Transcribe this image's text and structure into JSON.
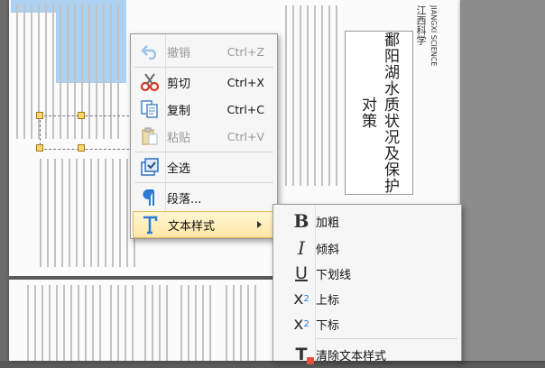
{
  "context_menu": {
    "items": [
      {
        "label": "撤销",
        "shortcut": "Ctrl+Z",
        "icon": "undo-icon",
        "enabled": false
      },
      {
        "label": "剪切",
        "shortcut": "Ctrl+X",
        "icon": "scissors-icon",
        "enabled": true
      },
      {
        "label": "复制",
        "shortcut": "Ctrl+C",
        "icon": "copy-icon",
        "enabled": true
      },
      {
        "label": "粘贴",
        "shortcut": "Ctrl+V",
        "icon": "paste-icon",
        "enabled": false
      },
      {
        "label": "全选",
        "icon": "select-all-icon",
        "enabled": true
      },
      {
        "label": "段落...",
        "icon": "paragraph-icon",
        "enabled": true
      },
      {
        "label": "文本样式",
        "icon": "text-style-icon",
        "enabled": true,
        "highlighted": true,
        "has_submenu": true
      }
    ]
  },
  "submenu": {
    "items": [
      {
        "label": "加粗",
        "icon": "bold-icon",
        "glyph": "B"
      },
      {
        "label": "倾斜",
        "icon": "italic-icon",
        "glyph": "I"
      },
      {
        "label": "下划线",
        "icon": "underline-icon",
        "glyph": "U"
      },
      {
        "label": "上标",
        "icon": "superscript-icon",
        "glyph": "x",
        "sup": "2"
      },
      {
        "label": "下标",
        "icon": "subscript-icon",
        "glyph": "x",
        "sub": "2"
      },
      {
        "label": "清除文本样式",
        "icon": "clear-style-icon",
        "glyph": "T"
      }
    ]
  },
  "document": {
    "article_title": "鄱阳湖水质状况及保护对策",
    "journal_name": "江西科学",
    "journal_en": "JIANGXI SCIENCE",
    "colors": {
      "selection": "#9ec9f0",
      "highlight": "#fde7a5",
      "accent_blue": "#2b7bd6"
    }
  }
}
